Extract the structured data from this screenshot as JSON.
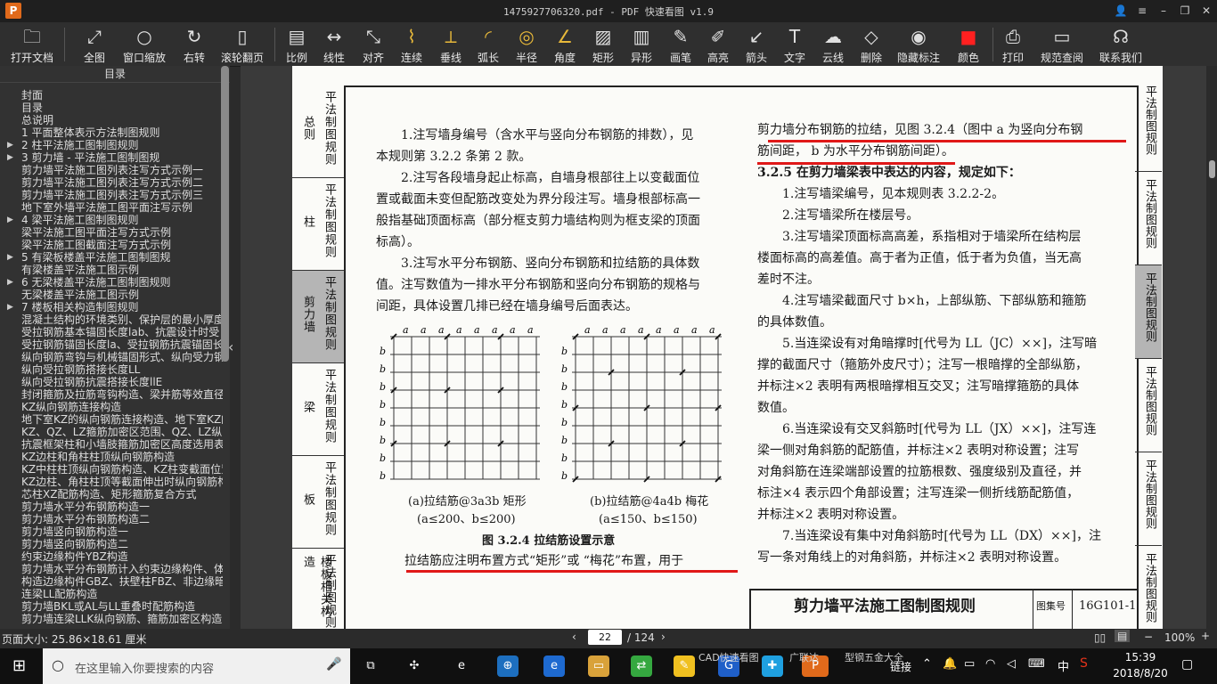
{
  "window": {
    "title": "1475927706320.pdf - PDF 快速看图 v1.9",
    "app_icon": "P",
    "buttons": [
      "user-icon",
      "menu-icon",
      "minimize-icon",
      "restore-icon",
      "close-icon"
    ]
  },
  "toolbar": {
    "tools": [
      {
        "label": "打开文档",
        "icon": "folder-icon"
      },
      {
        "label": "全图",
        "icon": "fit-icon"
      },
      {
        "label": "窗口缩放",
        "icon": "magnifier-icon"
      },
      {
        "label": "右转",
        "icon": "rotate-icon"
      },
      {
        "label": "滚轮翻页",
        "icon": "mouse-icon"
      },
      {
        "label": "比例",
        "icon": "ruler-icon"
      },
      {
        "label": "线性",
        "icon": "linear-dimension-icon"
      },
      {
        "label": "对齐",
        "icon": "aligned-dimension-icon"
      },
      {
        "label": "连续",
        "icon": "continuous-dimension-icon"
      },
      {
        "label": "垂线",
        "icon": "perpendicular-icon"
      },
      {
        "label": "弧长",
        "icon": "arc-length-icon"
      },
      {
        "label": "半径",
        "icon": "radius-icon"
      },
      {
        "label": "角度",
        "icon": "angle-icon"
      },
      {
        "label": "矩形",
        "icon": "rectangle-area-icon"
      },
      {
        "label": "异形",
        "icon": "polygon-area-icon"
      },
      {
        "label": "画笔",
        "icon": "pen-icon"
      },
      {
        "label": "高亮",
        "icon": "highlighter-icon"
      },
      {
        "label": "箭头",
        "icon": "arrow-icon"
      },
      {
        "label": "文字",
        "icon": "text-icon"
      },
      {
        "label": "云线",
        "icon": "cloud-icon"
      },
      {
        "label": "删除",
        "icon": "eraser-icon"
      },
      {
        "label": "隐藏标注",
        "icon": "hide-eye-icon"
      },
      {
        "label": "颜色",
        "icon": "color-swatch-icon"
      },
      {
        "label": "打印",
        "icon": "printer-icon"
      },
      {
        "label": "规范查阅",
        "icon": "book-icon"
      },
      {
        "label": "联系我们",
        "icon": "contact-icon"
      }
    ],
    "accent_yellow": "#e8b93a",
    "color_swatch": "#ff1a1a"
  },
  "sidebar": {
    "header": "目录",
    "items": [
      {
        "label": "封面",
        "arrow": ""
      },
      {
        "label": "目录",
        "arrow": ""
      },
      {
        "label": "总说明",
        "arrow": ""
      },
      {
        "label": "1 平面整体表示方法制图规则",
        "arrow": ""
      },
      {
        "label": "2 柱平法施工图制图规则",
        "arrow": "▶"
      },
      {
        "label": "3 剪力墙 - 平法施工图制图规",
        "arrow": "▶"
      },
      {
        "label": "剪力墙平法施工图列表注写方式示例一",
        "arrow": ""
      },
      {
        "label": "剪力墙平法施工图列表注写方式示例二",
        "arrow": ""
      },
      {
        "label": "剪力墙平法施工图列表注写方式示例三",
        "arrow": ""
      },
      {
        "label": "地下室外墙平法施工图平面注写示例",
        "arrow": ""
      },
      {
        "label": "4 梁平法施工图制图规则",
        "arrow": "▶"
      },
      {
        "label": "梁平法施工图平面注写方式示例",
        "arrow": ""
      },
      {
        "label": "梁平法施工图截面注写方式示例",
        "arrow": ""
      },
      {
        "label": "5 有梁板楼盖平法施工图制图规",
        "arrow": "▶"
      },
      {
        "label": "有梁楼盖平法施工图示例",
        "arrow": ""
      },
      {
        "label": "6 无梁楼盖平法施工图制图规则",
        "arrow": "▶"
      },
      {
        "label": "无梁楼盖平法施工图示例",
        "arrow": ""
      },
      {
        "label": "7 楼板相关构造制图规则",
        "arrow": "▶"
      },
      {
        "label": "混凝土结构的环境类别、保护层的最小厚度",
        "arrow": ""
      },
      {
        "label": "受拉钢筋基本锚固长度lab、抗震设计时受",
        "arrow": ""
      },
      {
        "label": "受拉钢筋锚固长度la、受拉钢筋抗震锚固长",
        "arrow": ""
      },
      {
        "label": "纵向钢筋弯钩与机械锚固形式、纵向受力钢",
        "arrow": ""
      },
      {
        "label": "纵向受拉钢筋搭接长度LL",
        "arrow": ""
      },
      {
        "label": "纵向受拉钢筋抗震搭接长度llE",
        "arrow": ""
      },
      {
        "label": "封闭箍筋及拉筋弯钩构造、梁并筋等效直径",
        "arrow": ""
      },
      {
        "label": "KZ纵向钢筋连接构造",
        "arrow": ""
      },
      {
        "label": "地下室KZ的纵向钢筋连接构造、地下室KZ的",
        "arrow": ""
      },
      {
        "label": "KZ、QZ、LZ箍筋加密区范围、QZ、LZ纵向钢",
        "arrow": ""
      },
      {
        "label": "抗震框架柱和小墙肢箍筋加密区高度选用表",
        "arrow": ""
      },
      {
        "label": "KZ边柱和角柱柱顶纵向钢筋构造",
        "arrow": ""
      },
      {
        "label": "KZ中柱柱顶纵向钢筋构造、KZ柱变截面位置",
        "arrow": ""
      },
      {
        "label": "KZ边柱、角柱柱顶等截面伸出时纵向钢筋构",
        "arrow": ""
      },
      {
        "label": "芯柱XZ配筋构造、矩形箍筋复合方式",
        "arrow": ""
      },
      {
        "label": "剪力墙水平分布钢筋构造一",
        "arrow": ""
      },
      {
        "label": "剪力墙水平分布钢筋构造二",
        "arrow": ""
      },
      {
        "label": "剪力墙竖向钢筋构造一",
        "arrow": ""
      },
      {
        "label": "剪力墙竖向钢筋构造二",
        "arrow": ""
      },
      {
        "label": "约束边缘构件YBZ构造",
        "arrow": ""
      },
      {
        "label": "剪力墙水平分布钢筋计入约束边缘构件、体",
        "arrow": ""
      },
      {
        "label": "构造边缘构件GBZ、扶壁柱FBZ、非边缘暗柱",
        "arrow": ""
      },
      {
        "label": "连梁LL配筋构造",
        "arrow": ""
      },
      {
        "label": "剪力墙BKL或AL与LL重叠时配筋构造",
        "arrow": ""
      },
      {
        "label": "剪力墙连梁LLK纵向钢筋、箍筋加密区构造",
        "arrow": ""
      }
    ]
  },
  "page": {
    "left_tabs": [
      {
        "a": "总则",
        "b": "平法制图规则"
      },
      {
        "a": "柱",
        "b": "平法制图规则"
      },
      {
        "a": "剪力墙",
        "b": "平法制图规则",
        "active": true
      },
      {
        "a": "梁",
        "b": "平法制图规则"
      },
      {
        "a": "板",
        "b": "平法制图规则"
      },
      {
        "a": "楼板相关构造",
        "b": "平法制图规则"
      }
    ],
    "right_tabs": [
      {
        "a": "平法制图规则"
      },
      {
        "a": "平法制图规则"
      },
      {
        "a": "平法制图规则",
        "active": true
      },
      {
        "a": "平法制图规则"
      },
      {
        "a": "平法制图规则"
      },
      {
        "a": "平法制图规则"
      }
    ],
    "left_col": [
      "1.注写墙身编号（含水平与竖向分布钢筋的排数），见",
      "本规则第 3.2.2 条第 2 款。",
      "2.注写各段墙身起止标高，自墙身根部往上以变截面位",
      "置或截面未变但配筋改变处为界分段注写。墙身根部标高一",
      "般指基础顶面标高（部分框支剪力墙结构则为框支梁的顶面",
      "标高）。",
      "3.注写水平分布钢筋、竖向分布钢筋和拉结筋的具体数",
      "值。注写数值为一排水平分布钢筋和竖向分布钢筋的规格与",
      "间距，具体设置几排已经在墙身编号后面表达。"
    ],
    "figure": {
      "a_label": "a",
      "b_label": "b",
      "caption_a1": "(a)拉结筋@3a3b 矩形",
      "caption_a2": "(a≤200、b≤200)",
      "caption_b1": "(b)拉结筋@4a4b 梅花",
      "caption_b2": "(a≤150、b≤150)",
      "title": "图 3.2.4 拉结筋设置示意"
    },
    "left_bottom": "拉结筋应注明布置方式“矩形”或 “梅花”布置，用于",
    "right_col": [
      "剪力墙分布钢筋的拉结，见图 3.2.4（图中 a 为竖向分布钢",
      "筋间距， b 为水平分布钢筋间距）。",
      "3.2.5 在剪力墙梁表中表达的内容，规定如下：",
      "1.注写墙梁编号，见本规则表 3.2.2-2。",
      "2.注写墙梁所在楼层号。",
      "3.注写墙梁顶面标高高差，系指相对于墙梁所在结构层",
      "楼面标高的高差值。高于者为正值，低于者为负值，当无高",
      "差时不注。",
      "4.注写墙梁截面尺寸 b×h，上部纵筋、下部纵筋和箍筋",
      "的具体数值。",
      "5.当连梁设有对角暗撑时[代号为 LL（JC）××]，注写暗",
      "撑的截面尺寸（箍筋外皮尺寸）；注写一根暗撑的全部纵筋，",
      "并标注×2 表明有两根暗撑相互交叉；注写暗撑箍筋的具体",
      "数值。",
      "6.当连梁设有交叉斜筋时[代号为 LL（JX）××]，注写连",
      "梁一侧对角斜筋的配筋值，并标注×2 表明对称设置；注写",
      "对角斜筋在连梁端部设置的拉筋根数、强度级别及直径，并",
      "标注×4 表示四个角部设置；注写连梁一侧折线筋配筋值，",
      "并标注×2 表明对称设置。",
      "7.当连梁设有集中对角斜筋时[代号为 LL（DX）××]，注",
      "写一条对角线上的对角斜筋，并标注×2 表明对称设置。"
    ],
    "title_block": {
      "name": "剪力墙平法施工图制图规则",
      "label": "图集号",
      "code": "16G101-1"
    },
    "annotation_color": "#e01818"
  },
  "status": {
    "page_size": "页面大小: 25.86×18.61 厘米",
    "current_page": "22",
    "total_pages": "/ 124",
    "zoom": "100%"
  },
  "taskbar": {
    "search_placeholder": "在这里输入你要搜索的内容",
    "labels": [
      "CAD快速看图",
      "广联达",
      "型钢五金大全",
      "链接"
    ],
    "time": "15:39",
    "date": "2018/8/20",
    "ime": "中"
  }
}
